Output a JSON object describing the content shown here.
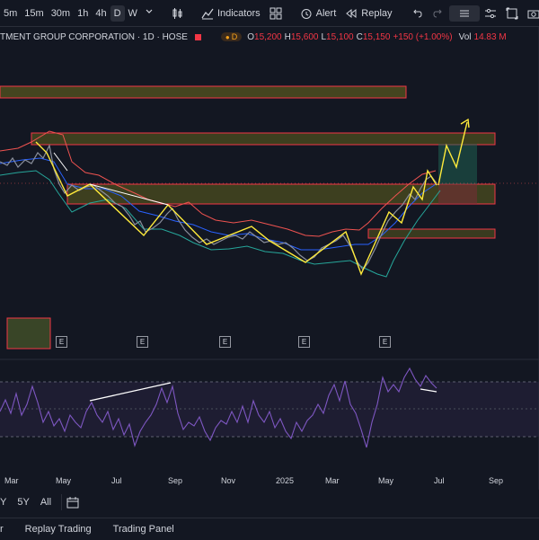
{
  "toolbar": {
    "timeframes": [
      "5m",
      "15m",
      "30m",
      "1h",
      "4h",
      "D",
      "W"
    ],
    "active_timeframe": "D",
    "indicators_label": "Indicators",
    "alert_label": "Alert",
    "replay_label": "Replay"
  },
  "legend": {
    "title": "TMENT GROUP CORPORATION · 1D · HOSE",
    "badge": "D",
    "open_label": "O",
    "open": "15,200",
    "high_label": "H",
    "high": "15,600",
    "low_label": "L",
    "low": "15,100",
    "close_label": "C",
    "close": "15,150",
    "change": "+150 (+1.00%)",
    "vol_label": "Vol",
    "vol": "14.83 M"
  },
  "x_axis": {
    "labels": [
      "Mar",
      "May",
      "Jul",
      "Sep",
      "Nov",
      "2025",
      "Mar",
      "May",
      "Jul",
      "Sep"
    ]
  },
  "earnings_markers": [
    "E",
    "E",
    "E",
    "E",
    "E"
  ],
  "date_range": {
    "options": [
      "Y",
      "5Y",
      "All"
    ]
  },
  "bottom_panel": {
    "tabs": [
      "r",
      "Replay Trading",
      "Trading Panel"
    ]
  },
  "colors": {
    "background": "#131722",
    "zone_fill": "#6b6a1f",
    "zone_border": "#f23645",
    "zigzag": "#ffeb3b",
    "rsi_line": "#7e57c2",
    "up_candle": "#26a69a",
    "down_candle": "#ef5350"
  }
}
